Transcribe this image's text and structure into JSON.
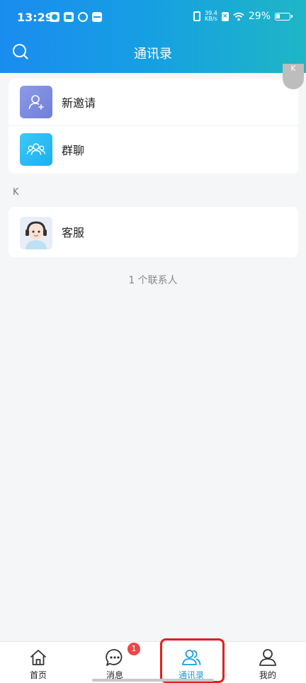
{
  "status_bar": {
    "time": "13:29",
    "net_speed_value": "39.4",
    "net_speed_unit": "KB/s",
    "battery": "29%"
  },
  "header": {
    "title": "通讯录",
    "search_icon": "search-icon"
  },
  "actions": [
    {
      "label": "新邀请",
      "icon": "add-user-icon"
    },
    {
      "label": "群聊",
      "icon": "group-icon"
    }
  ],
  "index_badge": "K",
  "section": {
    "letter": "K",
    "contacts": [
      {
        "name": "客服",
        "avatar": "support-avatar"
      }
    ]
  },
  "contact_count": "1 个联系人",
  "tabs": [
    {
      "label": "首页",
      "icon": "home-icon"
    },
    {
      "label": "消息",
      "icon": "message-icon",
      "badge": "1"
    },
    {
      "label": "通讯录",
      "icon": "contacts-icon",
      "active": true
    },
    {
      "label": "我的",
      "icon": "profile-icon"
    }
  ],
  "colors": {
    "accent": "#1a9bdc",
    "header_start": "#1a8cf0",
    "header_end": "#1fb6c6",
    "badge": "#e8484a",
    "highlight": "#e02020"
  }
}
